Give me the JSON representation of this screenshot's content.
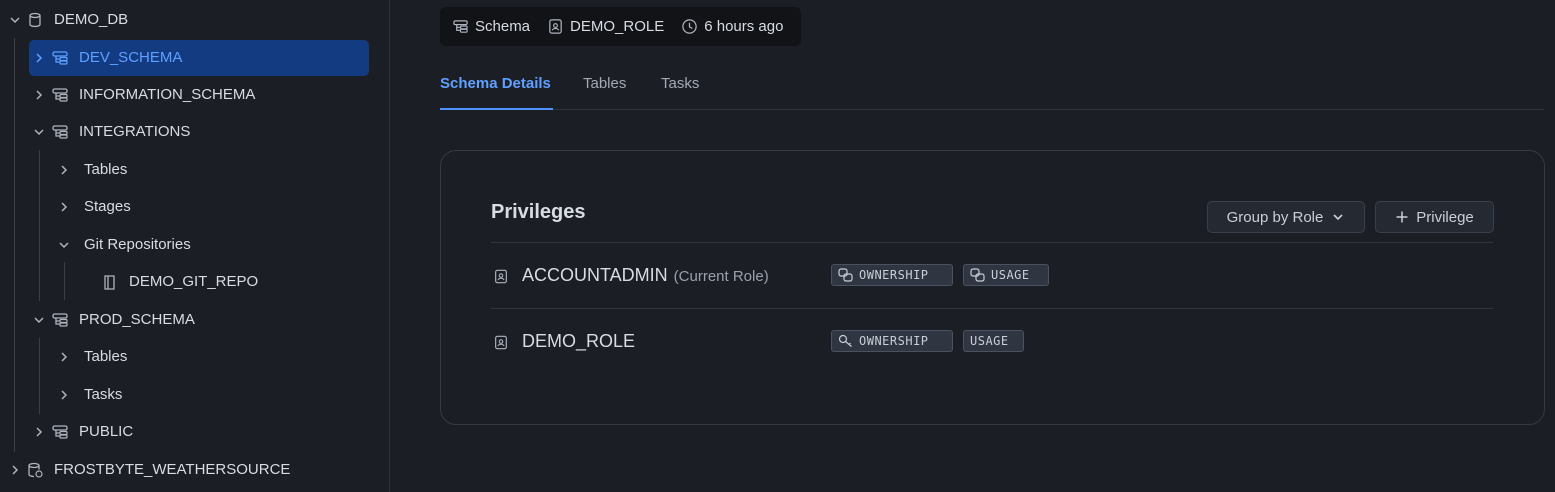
{
  "sidebar": {
    "db": "DEMO_DB",
    "dev_schema": "DEV_SCHEMA",
    "information_schema": "INFORMATION_SCHEMA",
    "integrations": "INTEGRATIONS",
    "integrations_tables": "Tables",
    "integrations_stages": "Stages",
    "integrations_git": "Git Repositories",
    "git_repo": "DEMO_GIT_REPO",
    "prod_schema": "PROD_SCHEMA",
    "prod_tables": "Tables",
    "prod_tasks": "Tasks",
    "public": "PUBLIC",
    "weathersource": "FROSTBYTE_WEATHERSOURCE"
  },
  "meta": {
    "type": "Schema",
    "owner": "DEMO_ROLE",
    "updated": "6 hours ago"
  },
  "tabs": [
    "Schema Details",
    "Tables",
    "Tasks"
  ],
  "privileges": {
    "title": "Privileges",
    "group_button": "Group by Role",
    "add_button": "Privilege",
    "rows": [
      {
        "role": "ACCOUNTADMIN",
        "note": "(Current Role)",
        "badges": [
          "OWNERSHIP",
          "USAGE"
        ]
      },
      {
        "role": "DEMO_ROLE",
        "note": "",
        "badges": [
          "OWNERSHIP",
          "USAGE"
        ]
      }
    ]
  },
  "colors": {
    "accent": "#4f8fff",
    "selected_bg": "#123b82",
    "background": "#1b1e24"
  }
}
